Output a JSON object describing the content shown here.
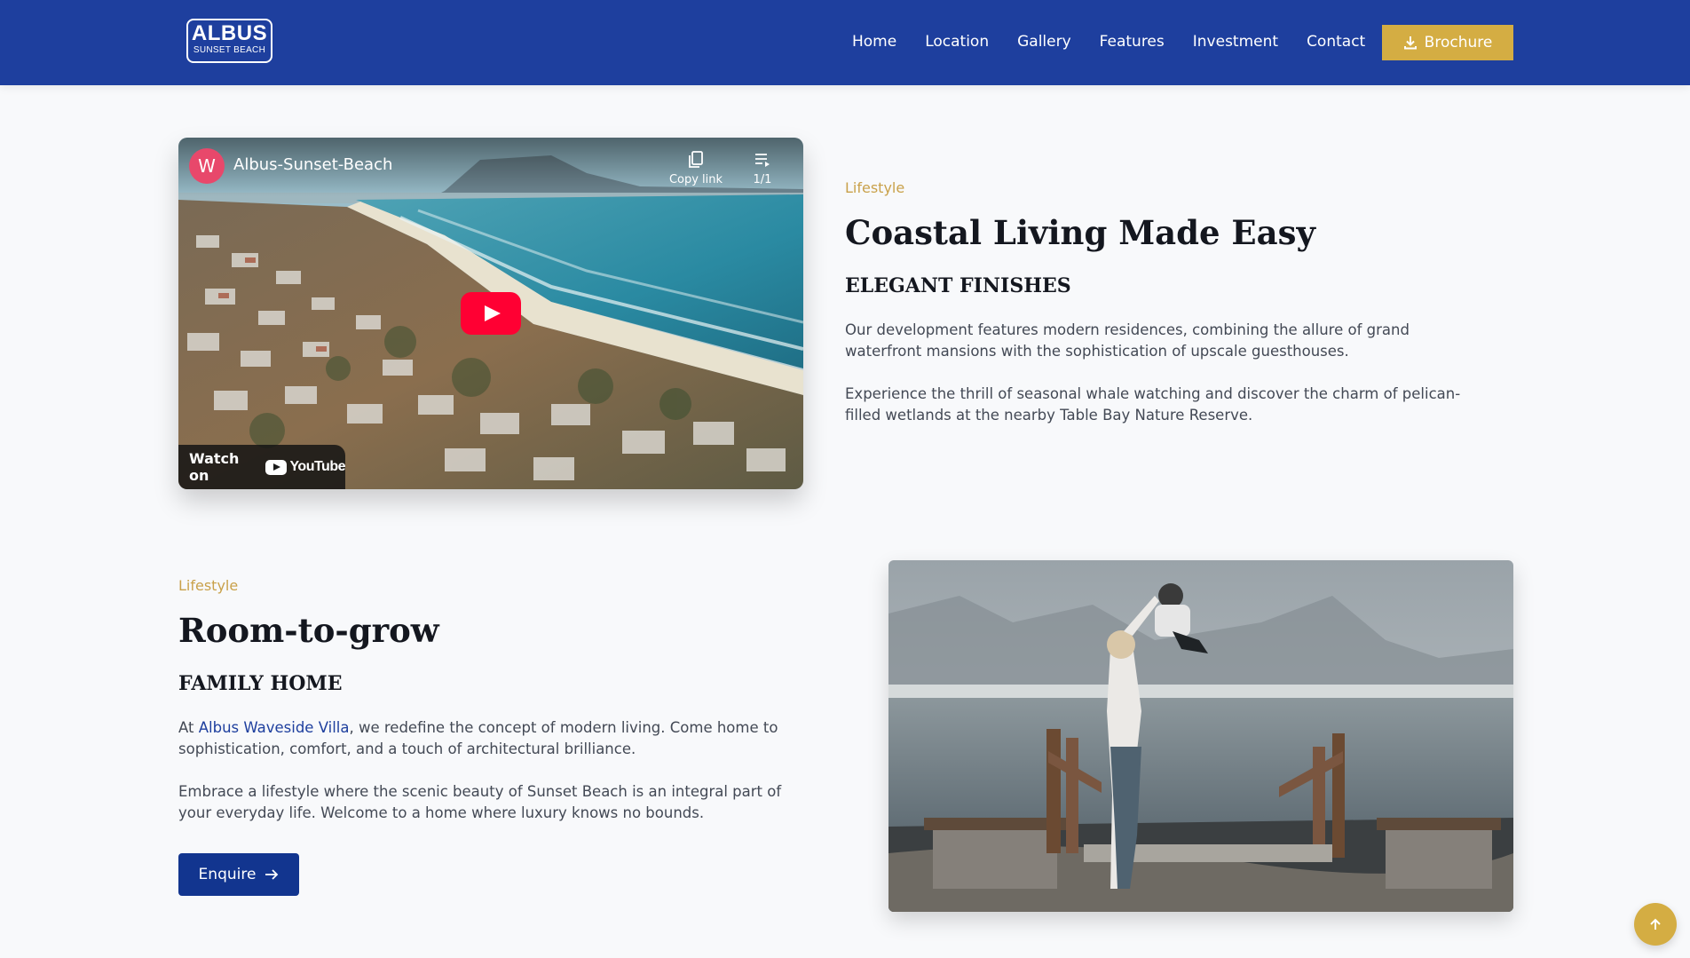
{
  "header": {
    "logo_main": "ALBUS",
    "logo_sub": "SUNSET BEACH",
    "nav": [
      "Home",
      "Location",
      "Gallery",
      "Features",
      "Investment",
      "Contact"
    ],
    "brochure_label": "Brochure",
    "brochure_icon": "download-icon",
    "background_color": "#1e3f9e",
    "accent_color": "#d4ad43"
  },
  "video": {
    "channel_initial": "W",
    "title": "Albus-Sunset-Beach",
    "copy_link_label": "Copy link",
    "playlist_count": "1/1",
    "watch_on_label": "Watch on",
    "youtube_label": "YouTube"
  },
  "section1": {
    "eyebrow": "Lifestyle",
    "heading": "Coastal Living Made Easy",
    "subheading": "ELEGANT FINISHES",
    "para1": "Our development features modern residences, combining the allure of grand waterfront mansions with the sophistication of upscale guesthouses.",
    "para2": "Experience the thrill of seasonal whale watching and discover the charm of pelican-filled wetlands at the nearby Table Bay Nature Reserve."
  },
  "section2": {
    "eyebrow": "Lifestyle",
    "heading": "Room-to-grow",
    "subheading": "FAMILY HOME",
    "para1_prefix": "At ",
    "para1_link": "Albus Waveside Villa",
    "para1_suffix": ", we redefine the concept of modern living. Come home to sophistication, comfort, and a touch of architectural brilliance.",
    "para2": "Embrace a lifestyle where the scenic beauty of Sunset Beach is an integral part of your everyday life. Welcome to a home where luxury knows no bounds.",
    "button_label": "Enquire"
  },
  "scroll_top_icon": "arrow-up-icon"
}
